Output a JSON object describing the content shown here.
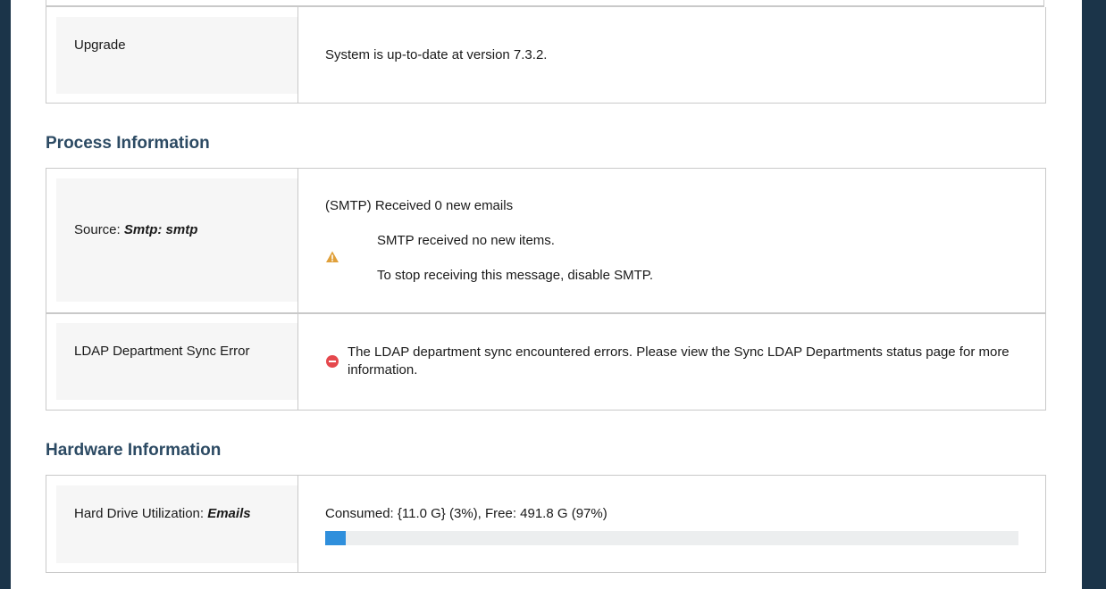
{
  "upgrade": {
    "label": "Upgrade",
    "message": "System is up-to-date at version 7.3.2."
  },
  "process_section": {
    "title": "Process Information",
    "source_row": {
      "label_prefix": "Source: ",
      "label_value": "Smtp: smtp",
      "headline": "(SMTP) Received 0 new emails",
      "warning_icon": "warning-triangle-icon",
      "warning_line1": "SMTP received no new items.",
      "warning_line2": "To stop receiving this message, disable SMTP."
    },
    "ldap_row": {
      "label": "LDAP Department Sync Error",
      "error_icon": "error-circle-icon",
      "message_line1": "The LDAP department sync encountered errors. Please view the Sync LDAP Departments status page for more",
      "message_line2": "information."
    }
  },
  "hardware_section": {
    "title": "Hardware Information",
    "drive_row": {
      "label_prefix": "Hard Drive Utilization: ",
      "label_value": "Emails",
      "usage_text": "Consumed: {11.0 G} (3%), Free: 491.8 G (97%)",
      "consumed_percent": 3
    }
  },
  "colors": {
    "frame": "#1b3449",
    "heading": "#2c4a63",
    "progress_fill": "#2f8fdc",
    "warning": "#e0a03a",
    "error": "#e5484d"
  }
}
